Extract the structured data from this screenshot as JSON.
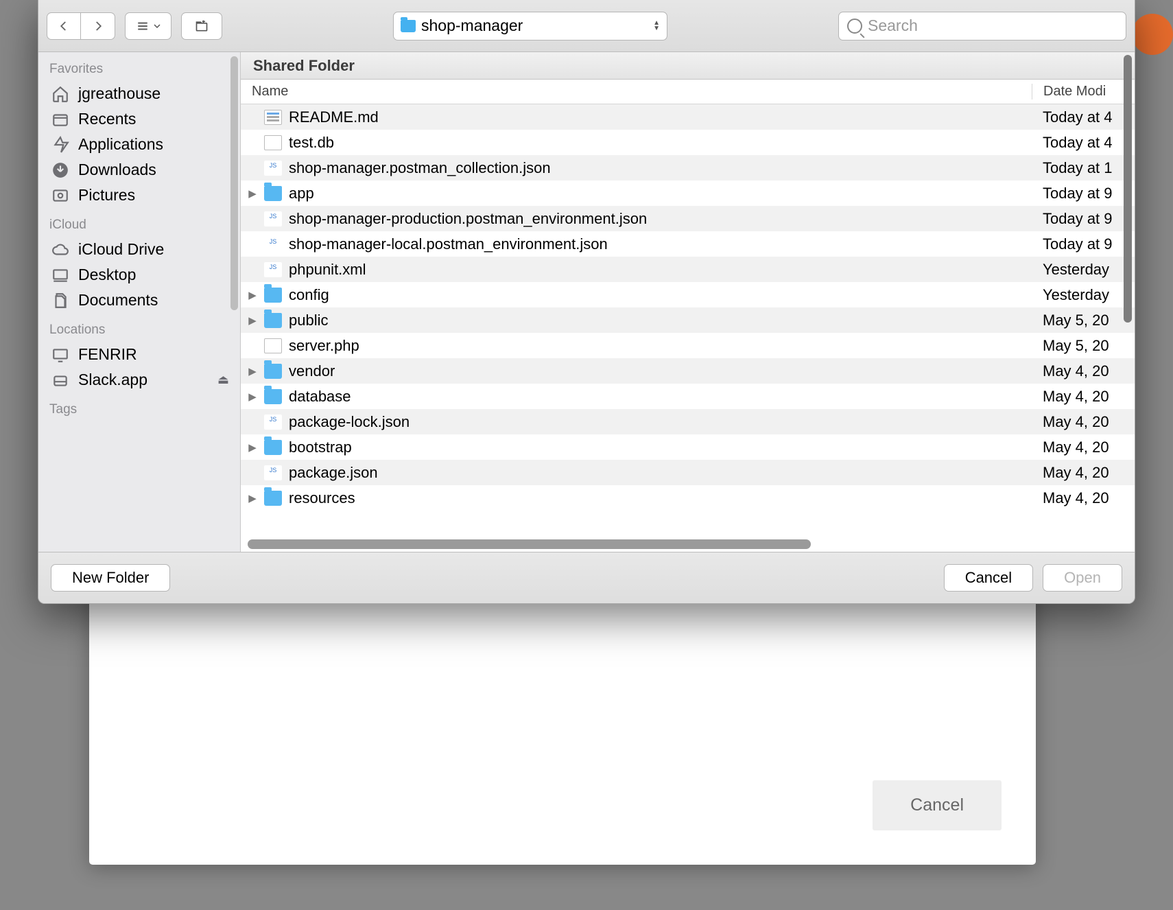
{
  "toolbar": {
    "path_label": "shop-manager",
    "search_placeholder": "Search"
  },
  "sidebar": {
    "sections": [
      {
        "label": "Favorites",
        "items": [
          {
            "icon": "home-icon",
            "label": "jgreathouse"
          },
          {
            "icon": "recents-icon",
            "label": "Recents"
          },
          {
            "icon": "applications-icon",
            "label": "Applications"
          },
          {
            "icon": "downloads-icon",
            "label": "Downloads"
          },
          {
            "icon": "pictures-icon",
            "label": "Pictures"
          }
        ]
      },
      {
        "label": "iCloud",
        "items": [
          {
            "icon": "cloud-icon",
            "label": "iCloud Drive"
          },
          {
            "icon": "desktop-icon",
            "label": "Desktop"
          },
          {
            "icon": "documents-icon",
            "label": "Documents"
          }
        ]
      },
      {
        "label": "Locations",
        "items": [
          {
            "icon": "computer-icon",
            "label": "FENRIR"
          },
          {
            "icon": "disk-icon",
            "label": "Slack.app",
            "eject": true
          }
        ]
      },
      {
        "label": "Tags",
        "items": []
      }
    ]
  },
  "listing": {
    "header": "Shared Folder",
    "columns": {
      "name": "Name",
      "date": "Date Modi"
    },
    "rows": [
      {
        "type": "doc",
        "name": "README.md",
        "date": "Today at 4"
      },
      {
        "type": "blank",
        "name": "test.db",
        "date": "Today at 4"
      },
      {
        "type": "js",
        "name": "shop-manager.postman_collection.json",
        "date": "Today at 1"
      },
      {
        "type": "folder",
        "name": "app",
        "date": "Today at 9"
      },
      {
        "type": "js",
        "name": "shop-manager-production.postman_environment.json",
        "date": "Today at 9"
      },
      {
        "type": "js",
        "name": "shop-manager-local.postman_environment.json",
        "date": "Today at 9"
      },
      {
        "type": "js",
        "name": "phpunit.xml",
        "date": "Yesterday"
      },
      {
        "type": "folder",
        "name": "config",
        "date": "Yesterday"
      },
      {
        "type": "folder",
        "name": "public",
        "date": "May 5, 20"
      },
      {
        "type": "blank",
        "name": "server.php",
        "date": "May 5, 20"
      },
      {
        "type": "folder",
        "name": "vendor",
        "date": "May 4, 20"
      },
      {
        "type": "folder",
        "name": "database",
        "date": "May 4, 20"
      },
      {
        "type": "js",
        "name": "package-lock.json",
        "date": "May 4, 20"
      },
      {
        "type": "folder",
        "name": "bootstrap",
        "date": "May 4, 20"
      },
      {
        "type": "js",
        "name": "package.json",
        "date": "May 4, 20"
      },
      {
        "type": "folder",
        "name": "resources",
        "date": "May 4, 20"
      }
    ]
  },
  "footer": {
    "new_folder": "New Folder",
    "cancel": "Cancel",
    "open": "Open"
  },
  "background": {
    "cancel": "Cancel"
  }
}
